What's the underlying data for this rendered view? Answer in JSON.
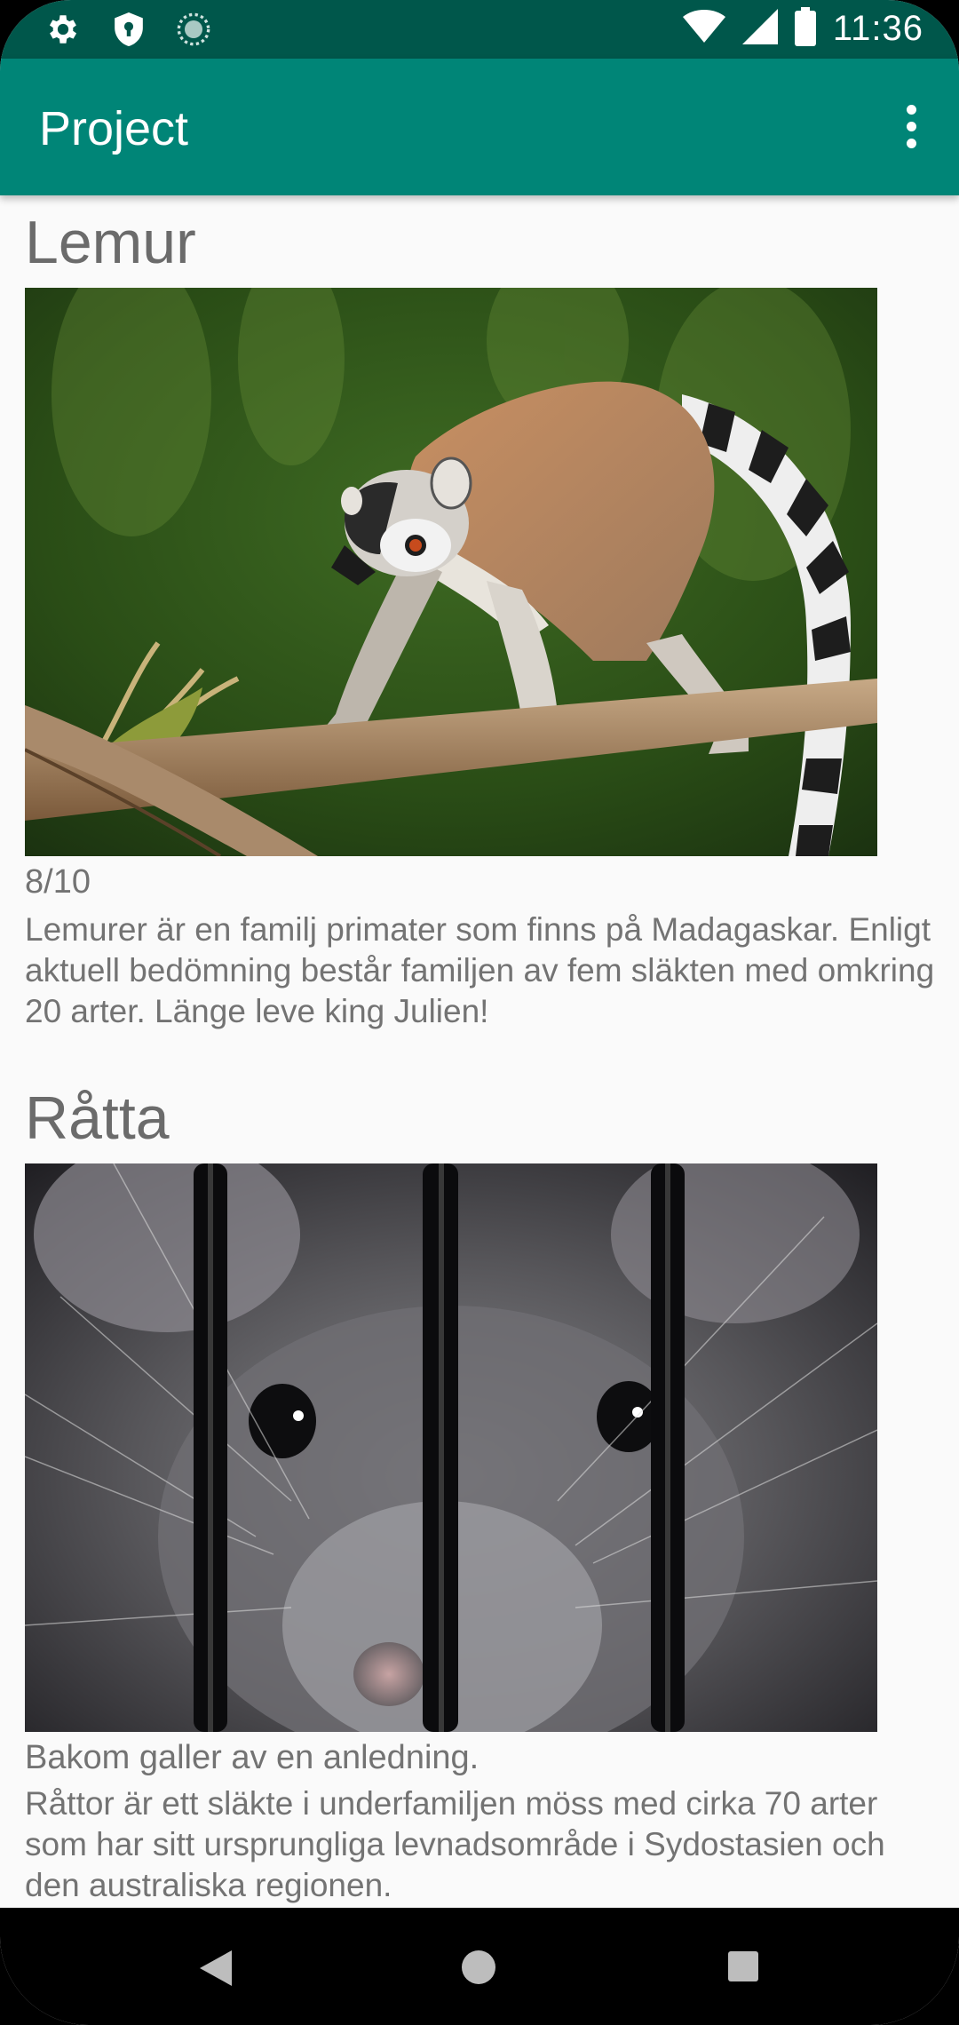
{
  "status_bar": {
    "time": "11:36",
    "icons_left": [
      "gear-icon",
      "shield-icon",
      "sync-icon"
    ],
    "icons_right": [
      "wifi-icon",
      "signal-icon",
      "battery-icon"
    ]
  },
  "app_bar": {
    "title": "Project",
    "menu_icon": "more-vert-icon"
  },
  "animals": [
    {
      "name": "Lemur",
      "image_subject": "ring-tailed lemur on a branch",
      "caption": "8/10",
      "description": "Lemurer är en familj primater som finns på Madagaskar. Enligt aktuell bedömning består familjen av fem släkten med omkring 20 arter. Länge leve king Julien!"
    },
    {
      "name": "Råtta",
      "image_subject": "rat behind bars",
      "caption": "Bakom galler av en anledning.",
      "description": "Råttor är ett släkte i underfamiljen möss med cirka 70 arter som har sitt ursprungliga levnadsområde i Sydostasien och den australiska regionen."
    }
  ],
  "nav_bar": {
    "buttons": [
      "back-icon",
      "home-icon",
      "recents-icon"
    ]
  },
  "colors": {
    "primary": "#008577",
    "primary_dark": "#00574b",
    "text_secondary": "#737373"
  }
}
